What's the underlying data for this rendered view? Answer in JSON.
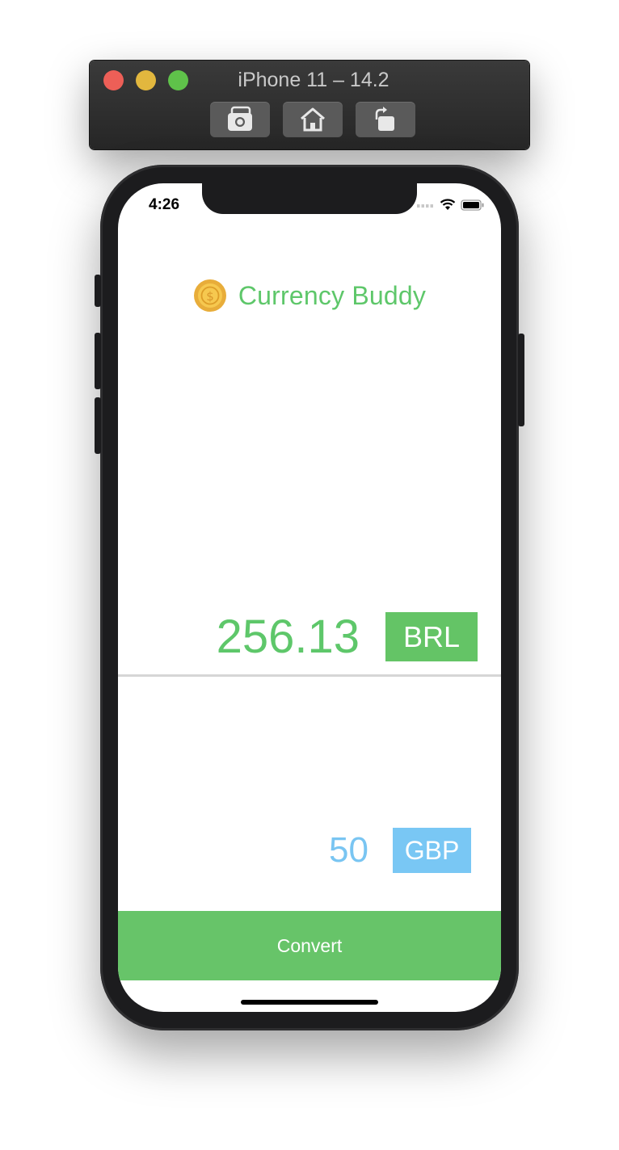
{
  "simulator": {
    "title": "iPhone 11 – 14.2",
    "buttons": [
      "screenshot-icon",
      "home-icon",
      "rotate-icon"
    ]
  },
  "status_bar": {
    "time": "4:26"
  },
  "app": {
    "title": "Currency Buddy",
    "result_value": "256.13",
    "result_currency": "BRL",
    "input_value": "50",
    "input_currency": "GBP",
    "convert_label": "Convert"
  },
  "colors": {
    "green": "#64c466",
    "blue": "#79c7f4",
    "coin": "#f2c14e"
  }
}
